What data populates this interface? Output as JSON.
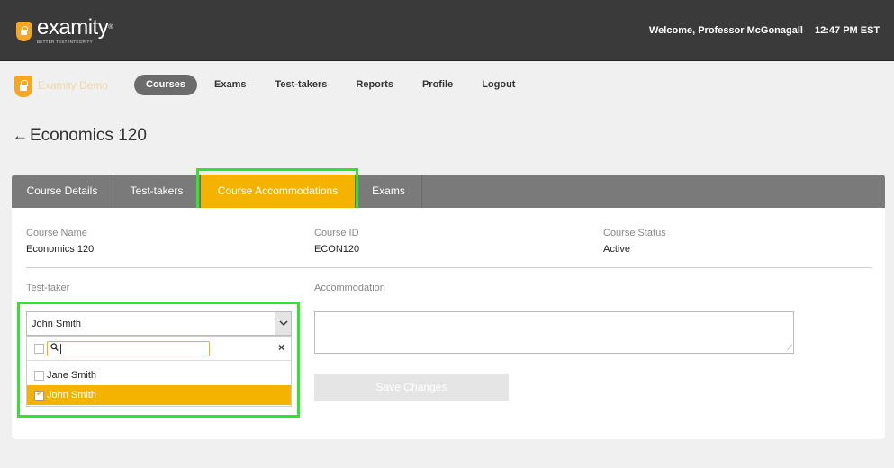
{
  "header": {
    "brand": "examity",
    "brand_mark": "®",
    "tagline": "BETTER TEST INTEGRITY",
    "welcome": "Welcome, Professor McGonagall",
    "time": "12:47 PM  EST"
  },
  "nav": {
    "org_name": "Examity Demo",
    "items": [
      "Courses",
      "Exams",
      "Test-takers",
      "Reports",
      "Profile",
      "Logout"
    ],
    "active": "Courses"
  },
  "page": {
    "back_arrow": "←",
    "title": "Economics 120"
  },
  "tabs": [
    "Course Details",
    "Test-takers",
    "Course Accommodations",
    "Exams"
  ],
  "active_tab": "Course Accommodations",
  "details": {
    "course_name_label": "Course Name",
    "course_name": "Economics 120",
    "course_id_label": "Course ID",
    "course_id": "ECON120",
    "course_status_label": "Course Status",
    "course_status": "Active"
  },
  "form": {
    "testtaker_label": "Test-taker",
    "testtaker_selected": "John Smith",
    "accommodation_label": "Accommodation",
    "accommodation_value": "",
    "save_label": "Save Changes",
    "dropdown": {
      "search_value": "",
      "close_symbol": "×",
      "options": [
        {
          "label": "Jane Smith",
          "checked": false
        },
        {
          "label": "John Smith",
          "checked": true
        }
      ]
    }
  },
  "colors": {
    "accent": "#f5b301",
    "highlight": "#2ee62e",
    "header_bg": "#3a3a3a",
    "tab_bg": "#7a7a7a"
  }
}
